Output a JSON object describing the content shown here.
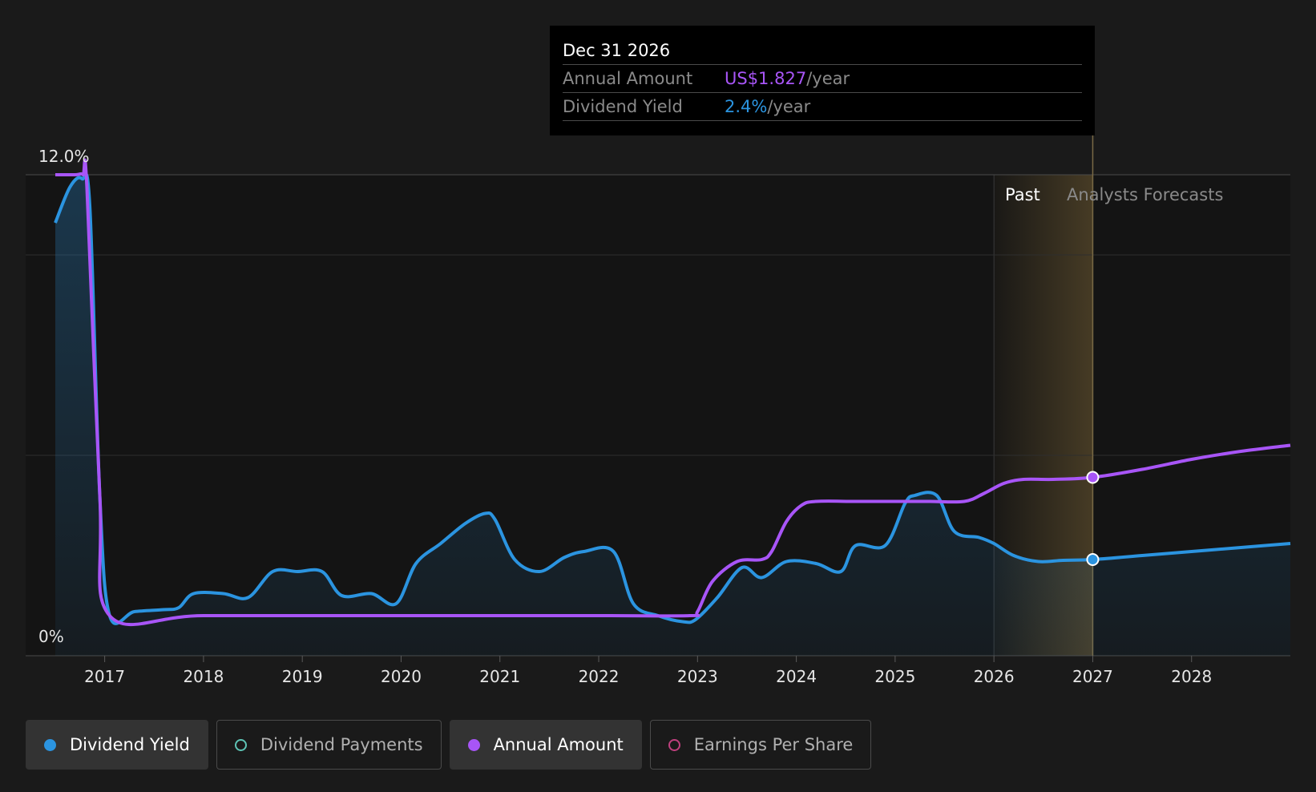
{
  "tooltip": {
    "date": "Dec 31 2026",
    "rows": [
      {
        "label": "Annual Amount",
        "value": "US$1.827",
        "unit": "/year",
        "color": "#a855f7"
      },
      {
        "label": "Dividend Yield",
        "value": "2.4%",
        "unit": "/year",
        "color": "#2b94e0"
      }
    ]
  },
  "legend": [
    {
      "label": "Dividend Yield",
      "color": "#2b94e0",
      "active": true
    },
    {
      "label": "Dividend Payments",
      "color": "#5ec4b6",
      "active": false
    },
    {
      "label": "Annual Amount",
      "color": "#a855f7",
      "active": true
    },
    {
      "label": "Earnings Per Share",
      "color": "#c0407e",
      "active": false
    }
  ],
  "chart_data": {
    "type": "line",
    "y_tick_labels": [
      "12.0%",
      "0%"
    ],
    "xlim": [
      2016.3,
      2029.0
    ],
    "ylim": [
      0,
      12
    ],
    "x_ticks": [
      2017,
      2018,
      2019,
      2020,
      2021,
      2022,
      2023,
      2024,
      2025,
      2026,
      2027,
      2028
    ],
    "past_label": "Past",
    "forecast_label": "Analysts Forecasts",
    "past_band": [
      2026.0,
      2027.0
    ],
    "marker_x": 2027.0,
    "colors": {
      "yield": "#2b94e0",
      "amount": "#a855f7"
    },
    "series": [
      {
        "name": "Dividend Yield",
        "points": [
          [
            2016.5,
            10.8
          ],
          [
            2016.65,
            11.7
          ],
          [
            2016.77,
            11.9
          ],
          [
            2016.85,
            11.2
          ],
          [
            2016.95,
            4.0
          ],
          [
            2017.05,
            1.0
          ],
          [
            2017.3,
            1.1
          ],
          [
            2017.6,
            1.15
          ],
          [
            2017.75,
            1.2
          ],
          [
            2017.9,
            1.55
          ],
          [
            2018.2,
            1.55
          ],
          [
            2018.45,
            1.45
          ],
          [
            2018.7,
            2.1
          ],
          [
            2018.95,
            2.1
          ],
          [
            2019.2,
            2.1
          ],
          [
            2019.4,
            1.5
          ],
          [
            2019.7,
            1.55
          ],
          [
            2019.95,
            1.3
          ],
          [
            2020.15,
            2.3
          ],
          [
            2020.4,
            2.8
          ],
          [
            2020.65,
            3.3
          ],
          [
            2020.85,
            3.55
          ],
          [
            2020.95,
            3.4
          ],
          [
            2021.15,
            2.4
          ],
          [
            2021.4,
            2.1
          ],
          [
            2021.65,
            2.45
          ],
          [
            2021.85,
            2.6
          ],
          [
            2022.15,
            2.6
          ],
          [
            2022.35,
            1.3
          ],
          [
            2022.6,
            1.0
          ],
          [
            2022.85,
            0.85
          ],
          [
            2022.98,
            0.9
          ],
          [
            2023.2,
            1.45
          ],
          [
            2023.45,
            2.2
          ],
          [
            2023.65,
            1.95
          ],
          [
            2023.9,
            2.35
          ],
          [
            2024.2,
            2.3
          ],
          [
            2024.45,
            2.1
          ],
          [
            2024.6,
            2.75
          ],
          [
            2024.9,
            2.75
          ],
          [
            2025.1,
            3.8
          ],
          [
            2025.2,
            4.0
          ],
          [
            2025.42,
            4.0
          ],
          [
            2025.6,
            3.1
          ],
          [
            2025.85,
            2.95
          ],
          [
            2026.0,
            2.8
          ],
          [
            2026.2,
            2.5
          ],
          [
            2026.45,
            2.35
          ],
          [
            2026.7,
            2.38
          ],
          [
            2027.0,
            2.4
          ],
          [
            2027.5,
            2.5
          ],
          [
            2028.0,
            2.6
          ],
          [
            2028.5,
            2.7
          ],
          [
            2029.0,
            2.8
          ]
        ]
      },
      {
        "name": "Annual Amount",
        "points": [
          [
            2016.5,
            12.0
          ],
          [
            2016.7,
            12.0
          ],
          [
            2016.78,
            12.0
          ],
          [
            2016.82,
            11.7
          ],
          [
            2016.95,
            4.0
          ],
          [
            2017.05,
            1.0
          ],
          [
            2018.0,
            1.0
          ],
          [
            2020.0,
            1.0
          ],
          [
            2022.0,
            1.0
          ],
          [
            2022.92,
            1.0
          ],
          [
            2023.0,
            1.1
          ],
          [
            2023.15,
            1.85
          ],
          [
            2023.4,
            2.35
          ],
          [
            2023.65,
            2.4
          ],
          [
            2023.75,
            2.6
          ],
          [
            2023.9,
            3.35
          ],
          [
            2024.05,
            3.75
          ],
          [
            2024.2,
            3.85
          ],
          [
            2024.6,
            3.85
          ],
          [
            2025.0,
            3.85
          ],
          [
            2025.35,
            3.85
          ],
          [
            2025.7,
            3.85
          ],
          [
            2025.9,
            4.05
          ],
          [
            2026.1,
            4.3
          ],
          [
            2026.3,
            4.4
          ],
          [
            2026.6,
            4.4
          ],
          [
            2027.0,
            4.45
          ],
          [
            2027.5,
            4.65
          ],
          [
            2028.0,
            4.9
          ],
          [
            2028.5,
            5.1
          ],
          [
            2029.0,
            5.25
          ]
        ]
      }
    ]
  }
}
